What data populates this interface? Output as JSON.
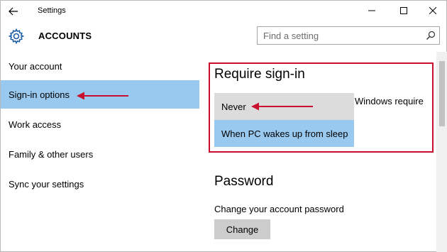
{
  "window": {
    "title": "Settings"
  },
  "header": {
    "title": "ACCOUNTS",
    "search_placeholder": "Find a setting"
  },
  "sidebar": {
    "items": [
      {
        "label": "Your account"
      },
      {
        "label": "Sign-in options",
        "selected": true
      },
      {
        "label": "Work access"
      },
      {
        "label": "Family & other users"
      },
      {
        "label": "Sync your settings"
      }
    ]
  },
  "content": {
    "require_signin": {
      "title": "Require sign-in",
      "description_fragment": "Windows require",
      "options": [
        "Never",
        "When PC wakes up from sleep"
      ]
    },
    "password": {
      "title": "Password",
      "caption": "Change your account password",
      "button_label": "Change"
    }
  },
  "colors": {
    "selected": "#99c9ef",
    "annotation": "#c8102e",
    "option_bg": "#dcdcdc"
  }
}
